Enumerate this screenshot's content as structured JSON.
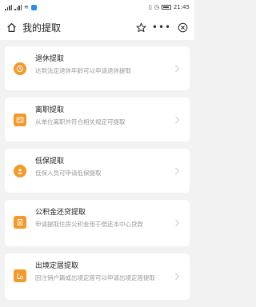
{
  "status_bar": {
    "time": "21:45",
    "battery": ""
  },
  "header": {
    "title": "我的提取"
  },
  "colors": {
    "accent": "#f39a2b",
    "background": "#f2f2f2",
    "card": "#ffffff"
  },
  "items": [
    {
      "title": "退休提取",
      "desc": "达到法定退休年龄可以申请退休提取",
      "icon": "clock-user-icon"
    },
    {
      "title": "离职提取",
      "desc": "从单位离职并符合相关规定可提取",
      "icon": "id-card-icon"
    },
    {
      "title": "低保提取",
      "desc": "低保人员可申请低保提取",
      "icon": "person-shield-icon"
    },
    {
      "title": "公积金还贷提取",
      "desc": "申请提取住房公积金用于偿还本中心贷款",
      "icon": "loan-document-icon"
    },
    {
      "title": "出境定居提取",
      "desc": "因注销户籍或出境定居可以申请出境定居提取",
      "icon": "passport-icon"
    }
  ]
}
